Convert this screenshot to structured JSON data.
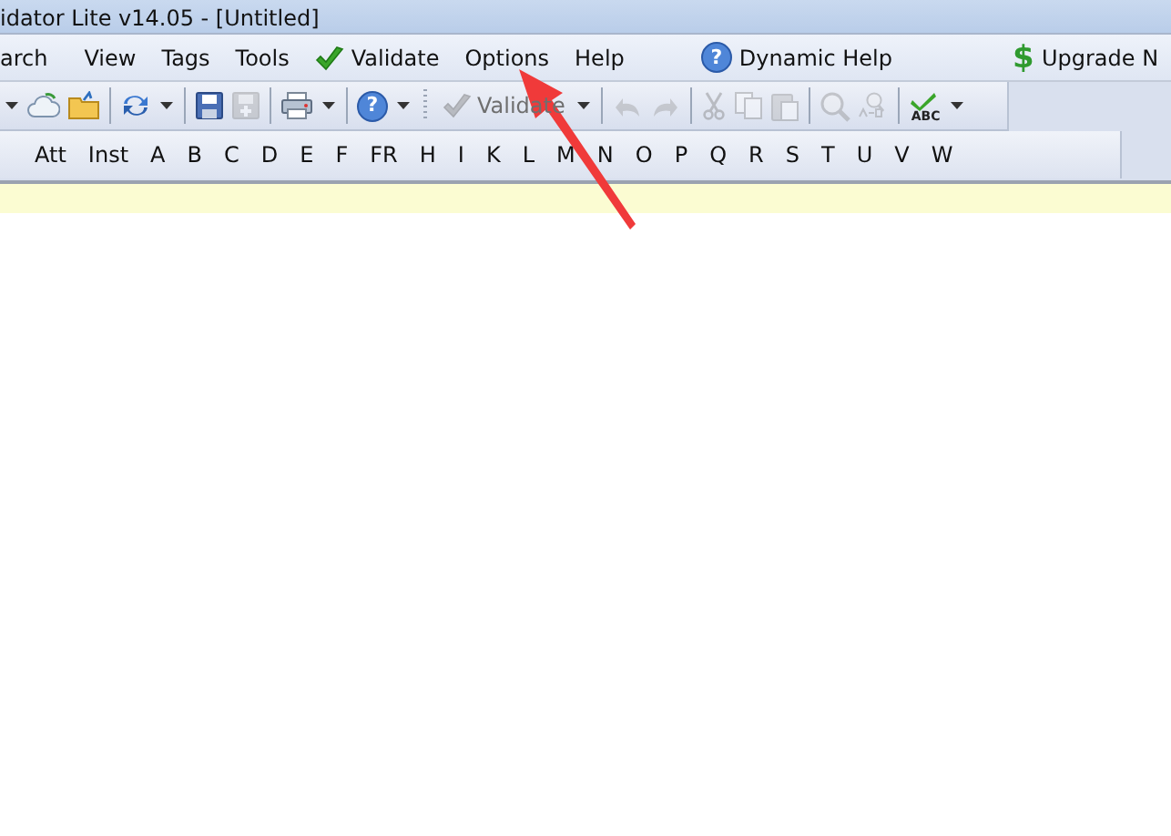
{
  "window": {
    "title": "idator Lite v14.05 - [Untitled]"
  },
  "menu": [
    {
      "kind": "plain",
      "label": "arch"
    },
    {
      "kind": "plain",
      "label": "View"
    },
    {
      "kind": "plain",
      "label": "Tags"
    },
    {
      "kind": "plain",
      "label": "Tools"
    },
    {
      "kind": "check",
      "label": "Validate"
    },
    {
      "kind": "plain",
      "label": "Options"
    },
    {
      "kind": "plain",
      "label": "Help"
    },
    {
      "kind": "separator"
    },
    {
      "kind": "help",
      "glyph": "?",
      "label": "Dynamic Help"
    },
    {
      "kind": "separator"
    },
    {
      "kind": "dollar",
      "glyph": "$",
      "label": "Upgrade N"
    }
  ],
  "toolbar": [
    {
      "kind": "caret",
      "disabled": false
    },
    {
      "kind": "cloud",
      "disabled": false
    },
    {
      "kind": "folder",
      "disabled": false
    },
    {
      "kind": "separator"
    },
    {
      "kind": "refresh",
      "disabled": false
    },
    {
      "kind": "caret",
      "disabled": false
    },
    {
      "kind": "separator"
    },
    {
      "kind": "save",
      "disabled": false
    },
    {
      "kind": "save-all",
      "disabled": true
    },
    {
      "kind": "separator"
    },
    {
      "kind": "printer",
      "disabled": false
    },
    {
      "kind": "caret",
      "disabled": false
    },
    {
      "kind": "separator"
    },
    {
      "kind": "help",
      "glyph": "?",
      "disabled": false
    },
    {
      "kind": "caret",
      "disabled": false
    },
    {
      "kind": "grip"
    },
    {
      "kind": "text-button",
      "label": "Validate",
      "disabled": true
    },
    {
      "kind": "caret"
    },
    {
      "kind": "separator"
    },
    {
      "kind": "undo",
      "disabled": true
    },
    {
      "kind": "redo",
      "disabled": true
    },
    {
      "kind": "separator"
    },
    {
      "kind": "cut",
      "disabled": true
    },
    {
      "kind": "copy",
      "disabled": true
    },
    {
      "kind": "paste",
      "disabled": true
    },
    {
      "kind": "separator"
    },
    {
      "kind": "find",
      "disabled": true
    },
    {
      "kind": "replace",
      "disabled": true
    },
    {
      "kind": "separator"
    },
    {
      "kind": "spellcheck",
      "glyph": "ABC",
      "disabled": false
    },
    {
      "kind": "caret",
      "disabled": false
    }
  ],
  "tag_bar": [
    "Att",
    "Inst",
    "A",
    "B",
    "C",
    "D",
    "E",
    "F",
    "FR",
    "H",
    "I",
    "K",
    "L",
    "M",
    "N",
    "O",
    "P",
    "Q",
    "R",
    "S",
    "T",
    "U",
    "V",
    "W"
  ],
  "annotation": {
    "kind": "arrow"
  }
}
